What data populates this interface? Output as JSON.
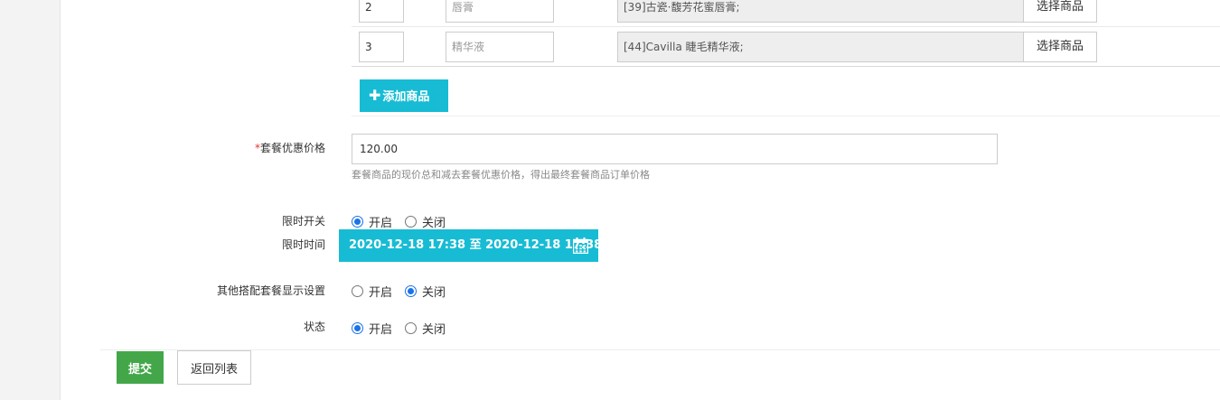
{
  "goods_rows": [
    {
      "index": "2",
      "alias": "唇膏",
      "product": "[39]古瓷·馥芳花蜜唇膏;",
      "select_label": "选择商品"
    },
    {
      "index": "3",
      "alias": "精华液",
      "product": "[44]Cavilla 睫毛精华液;",
      "select_label": "选择商品"
    }
  ],
  "add_goods_label": "添加商品",
  "price": {
    "required_mark": "*",
    "label": "套餐优惠价格",
    "value": "120.00",
    "hint": "套餐商品的现价总和减去套餐优惠价格，得出最终套餐商品订单价格"
  },
  "time_limit_switch": {
    "label": "限时开关",
    "options": [
      "开启",
      "关闭"
    ],
    "selected": "开启"
  },
  "time_limit_range": {
    "label": "限时时间",
    "value": "2020-12-18 17:38 至 2020-12-18 17:38"
  },
  "other_combo_display": {
    "label": "其他搭配套餐显示设置",
    "options": [
      "开启",
      "关闭"
    ],
    "selected": "关闭"
  },
  "status": {
    "label": "状态",
    "options": [
      "开启",
      "关闭"
    ],
    "selected": "开启"
  },
  "actions": {
    "submit_label": "提交",
    "back_label": "返回列表"
  },
  "colors": {
    "accent": "#17bcd4",
    "submit": "#43a74a",
    "required": "#e3342f",
    "radio": "#1a73e8"
  }
}
